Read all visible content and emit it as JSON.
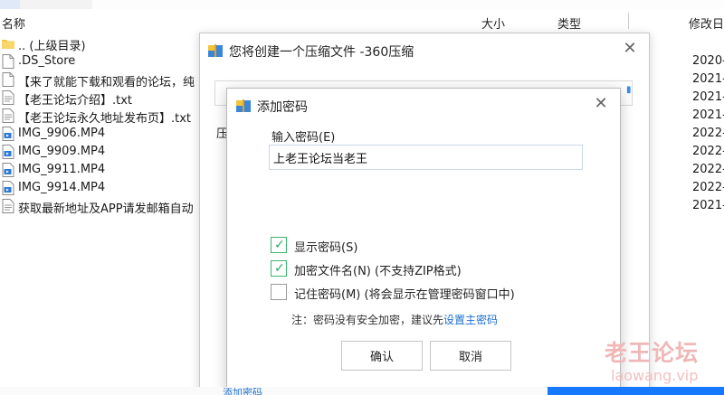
{
  "file_list": {
    "columns": {
      "name": "名称",
      "size": "大小",
      "type": "类型",
      "modified": "修改日"
    },
    "rows": [
      {
        "name": ".. (上级目录)",
        "date": "",
        "icon": "folder-icon"
      },
      {
        "name": ".DS_Store",
        "date": "2020-",
        "icon": "file-icon"
      },
      {
        "name": "【来了就能下载和观看的论坛，纯",
        "date": "2021-",
        "icon": "file-icon"
      },
      {
        "name": "【老王论坛介绍】.txt",
        "date": "2021-",
        "icon": "text-file-icon"
      },
      {
        "name": "【老王论坛永久地址发布页】.txt",
        "date": "2021-",
        "icon": "text-file-icon"
      },
      {
        "name": "IMG_9906.MP4",
        "date": "2022-",
        "icon": "video-file-icon"
      },
      {
        "name": "IMG_9909.MP4",
        "date": "2022-",
        "icon": "video-file-icon"
      },
      {
        "name": "IMG_9911.MP4",
        "date": "2022-",
        "icon": "video-file-icon"
      },
      {
        "name": "IMG_9914.MP4",
        "date": "2022-",
        "icon": "video-file-icon"
      },
      {
        "name": "获取最新地址及APP请发邮箱自动",
        "date": "2021-",
        "icon": "text-file-icon"
      }
    ],
    "bottom_link": "添加密码"
  },
  "outer_dialog": {
    "title": "您将创建一个压缩文件 -360压缩",
    "field_label": "压"
  },
  "password_dialog": {
    "title": "添加密码",
    "password_label": "输入密码(E)",
    "password_value": "上老王论坛当老王",
    "options": [
      {
        "label": "显示密码(S)",
        "checked": true
      },
      {
        "label": "加密文件名(N) (不支持ZIP格式)",
        "checked": true
      },
      {
        "label": "记住密码(M) (将会显示在管理密码窗口中)",
        "checked": false
      }
    ],
    "note_text": "注：密码没有安全加密，建议先",
    "note_link": "设置主密码",
    "ok_label": "确认",
    "cancel_label": "取消"
  },
  "watermark": {
    "title": "老王论坛",
    "url": "laowang.vip"
  },
  "colors": {
    "accent": "#1c6fd0",
    "check": "#2fa85f",
    "watermark": "#f0b7b7"
  }
}
